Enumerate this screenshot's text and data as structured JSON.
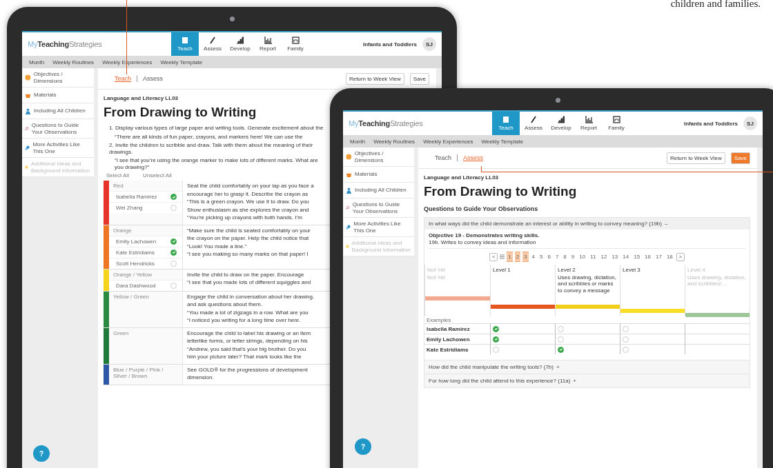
{
  "caption": "children and families.",
  "teach_tablet": {
    "header": {
      "logo": {
        "prefix": "My",
        "bold": "Teaching",
        "suffix": "Strategies"
      },
      "nav": [
        {
          "kind": "book",
          "label": "Teach",
          "selected": true
        },
        {
          "kind": "pencil",
          "label": "Assess",
          "selected": false
        },
        {
          "kind": "steps",
          "label": "Develop",
          "selected": false
        },
        {
          "kind": "chart",
          "label": "Report",
          "selected": false
        },
        {
          "kind": "family",
          "label": "Family",
          "selected": false
        }
      ],
      "program": "Infants and Toddlers",
      "avatar": "SJ"
    },
    "subnav": [
      "Month",
      "Weekly Routines",
      "Weekly Experiences",
      "Weekly Template"
    ],
    "sidebar": [
      {
        "kind": "objectives",
        "label": "Objectives / Dimensions",
        "disabled": false
      },
      {
        "kind": "materials",
        "label": "Materials",
        "disabled": false
      },
      {
        "kind": "inclusion",
        "label": "Including All Children",
        "disabled": false
      },
      {
        "kind": "questions",
        "label": "Questions to Guide Your Observations",
        "disabled": false
      },
      {
        "kind": "activities",
        "label": "More Activities Like This One",
        "disabled": false
      },
      {
        "kind": "ideas",
        "label": "Additional Ideas and Background Information",
        "disabled": true
      }
    ],
    "tabs": [
      {
        "label": "Teach",
        "selected": true
      },
      {
        "label": "Assess",
        "selected": false
      }
    ],
    "buttons": [
      {
        "label": "Return to Week View",
        "primary": false
      },
      {
        "label": "Save",
        "primary": false
      }
    ],
    "subject": "Language and Literacy LL03",
    "title": "From Drawing to Writing",
    "steps": [
      {
        "number": "1.",
        "text": "Display various types of large paper and writing tools. Generate excitement about the",
        "quote": "“There are all kinds of fun paper, crayons, and markers here! We can use the"
      },
      {
        "number": "2.",
        "text": "Invite the children to scribble and draw. Talk with them about the meaning of their drawings.",
        "quote": "“I see that you’re using the orange marker to make lots of different marks. What are you drawing?”"
      }
    ],
    "select_all": "Select All",
    "unselect_all": "Unselect All",
    "bands": [
      {
        "label": "Red",
        "color": "#e5352a",
        "students": [
          {
            "name": "Isabella Ramirez",
            "checked": true
          },
          {
            "name": "Wei Zhang",
            "checked": false
          }
        ],
        "texts": [
          "Seat the child comfortably on your lap as you face a",
          "encourage her to grasp it. Describe the crayon as",
          "“This is a green crayon. We use it to draw. Do you",
          "Show enthusiasm as she explores the crayon and",
          "“You’re picking up crayons with both hands. I’m"
        ]
      },
      {
        "label": "Orange",
        "color": "#ef7622",
        "students": [
          {
            "name": "Emily Lachowen",
            "checked": true
          },
          {
            "name": "Kate Estridiams",
            "checked": true
          },
          {
            "name": "Scott Hendricks",
            "checked": false
          }
        ],
        "texts": [
          "“Make sure the child is seated comfortably on your",
          "the crayon on the paper. Help the child notice that",
          "“Look! You made a line.”",
          "“I see you making so many marks on that paper! I"
        ]
      },
      {
        "label": "Orange / Yellow",
        "color": "#f6d31c",
        "students": [
          {
            "name": "Dara Dashwood",
            "checked": false
          }
        ],
        "texts": [
          "Invite the child to draw on the paper. Encourage",
          "“I see that you made lots of different squiggles and"
        ]
      },
      {
        "label": "Yellow / Green",
        "color": "#2a8a3f",
        "texts": [
          "Engage the child in conversation about her drawing.",
          "and ask questions about them.",
          "“You made a lot of zigzags in a row. What are you",
          "“I noticed you writing for a long time over here."
        ]
      },
      {
        "label": "Green",
        "color": "#1f7a3a",
        "texts": [
          "Encourage the child to label his drawing or an item",
          "letterlike forms, or letter strings, depending on his",
          "“Andrew, you said that’s your big brother. Do you",
          "him your picture later? That mark looks like the"
        ]
      },
      {
        "label": "Blue / Purple / Pink / Silver / Brown",
        "color": "#2b57a6",
        "texts": [
          "See GOLD® for the progressions of development",
          "dimension."
        ]
      }
    ]
  },
  "assess_tablet": {
    "header": {
      "logo": {
        "prefix": "My",
        "bold": "Teaching",
        "suffix": "Strategies"
      },
      "nav": [
        {
          "kind": "book",
          "label": "Teach",
          "selected": true
        },
        {
          "kind": "pencil",
          "label": "Assess",
          "selected": false
        },
        {
          "kind": "steps",
          "label": "Develop",
          "selected": false
        },
        {
          "kind": "chart",
          "label": "Report",
          "selected": false
        },
        {
          "kind": "family",
          "label": "Family",
          "selected": false
        }
      ],
      "program": "Infants and Toddlers",
      "avatar": "SJ"
    },
    "subnav": [
      "Month",
      "Weekly Routines",
      "Weekly Experiences",
      "Weekly Template"
    ],
    "sidebar": [
      {
        "kind": "objectives",
        "label": "Objectives / Dimensions",
        "disabled": false
      },
      {
        "kind": "materials",
        "label": "Materials",
        "disabled": false
      },
      {
        "kind": "inclusion",
        "label": "Including All Children",
        "disabled": false
      },
      {
        "kind": "questions",
        "label": "Questions to Guide Your Observations",
        "disabled": false
      },
      {
        "kind": "activities",
        "label": "More Activities Like This One",
        "disabled": false
      },
      {
        "kind": "ideas",
        "label": "Additional Ideas and Background Information",
        "disabled": true
      }
    ],
    "tabs": [
      {
        "label": "Teach",
        "selected": false
      },
      {
        "label": "Assess",
        "selected": true
      }
    ],
    "buttons": [
      {
        "label": "Return to Week View",
        "primary": false
      },
      {
        "label": "Save",
        "primary": true
      }
    ],
    "subject": "Language and Literacy LL03",
    "title": "From Drawing to Writing",
    "section": "Questions to Guide Your Observations",
    "question": {
      "text": "In what ways did the child demonstrate an interest or ability in writing to convey meaning? (19b)",
      "toggle": "–"
    },
    "objective": "Objective 19 - Demonstrates writing skills.",
    "dimension": "19b. Writes to convey ideas and information",
    "pager": {
      "prev": "<",
      "next": ">",
      "pages": [
        {
          "label": "1",
          "selected": true
        },
        {
          "label": "2",
          "selected": true
        },
        {
          "label": "3",
          "selected": true
        },
        {
          "label": "4",
          "selected": false
        },
        {
          "label": "5",
          "selected": false
        },
        {
          "label": "6",
          "selected": false
        },
        {
          "label": "7",
          "selected": false
        },
        {
          "label": "8",
          "selected": false
        },
        {
          "label": "9",
          "selected": false
        },
        {
          "label": "10",
          "selected": false
        },
        {
          "label": "11",
          "selected": false
        },
        {
          "label": "12",
          "selected": false
        },
        {
          "label": "13",
          "selected": false
        },
        {
          "label": "14",
          "selected": false
        },
        {
          "label": "15",
          "selected": false
        },
        {
          "label": "16",
          "selected": false
        },
        {
          "label": "17",
          "selected": false
        },
        {
          "label": "18",
          "selected": false
        }
      ]
    },
    "levels": [
      {
        "label": "Not Yet",
        "description": "Not Yet",
        "dimmed": true,
        "color": "#f3a98f"
      },
      {
        "label": "Level 1",
        "dimmed": false,
        "color": "#e8561f"
      },
      {
        "label": "Level 2",
        "description": "Uses drawing, dictation, and scribbles or marks to convey a message",
        "dimmed": false,
        "color": "#f2cf1d"
      },
      {
        "label": "Level 3",
        "dimmed": false,
        "color": "#f8de28"
      },
      {
        "label": "Level 4",
        "description": "Uses drawing, dictation, and scribbles/…",
        "dimmed": true,
        "color": "#9dc699"
      }
    ],
    "examples_label": "Examples",
    "examples": [
      {
        "name": "Isabella Ramirez",
        "marks": [
          {
            "checked": true
          },
          {
            "checked": false
          },
          {
            "checked": false
          }
        ]
      },
      {
        "name": "Emily Lachowen",
        "marks": [
          {
            "checked": true
          },
          {
            "checked": false
          },
          {
            "checked": false
          }
        ]
      },
      {
        "name": "Kate Estridiams",
        "marks": [
          {
            "checked": false
          },
          {
            "checked": true
          },
          {
            "checked": false
          }
        ]
      }
    ],
    "more_questions": [
      {
        "text": "How did the child manipulate the writing tools? (7b)",
        "toggle": "+"
      },
      {
        "text": "For how long did the child attend to this experience? (11a)",
        "toggle": "+"
      }
    ]
  },
  "help": [
    "?",
    "?"
  ]
}
